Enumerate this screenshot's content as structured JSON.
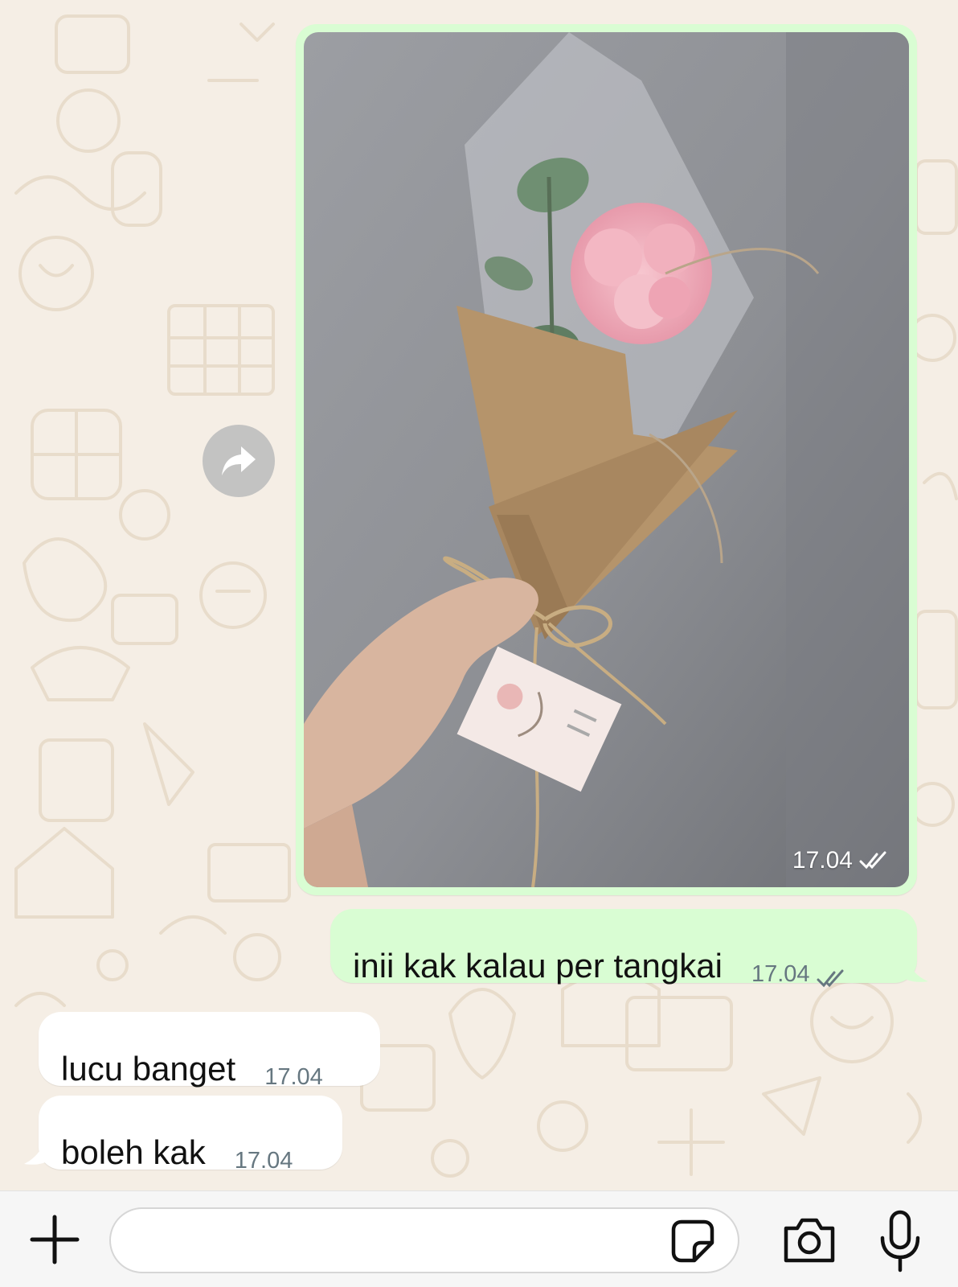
{
  "conversation": {
    "messages": [
      {
        "direction": "outgoing",
        "type": "image",
        "time": "17.04",
        "status_icon": "double-check-icon",
        "image_desc_icon": "flower-bouquet-photo"
      },
      {
        "direction": "outgoing",
        "type": "text",
        "text": "inii kak kalau per tangkai",
        "time": "17.04",
        "status_icon": "double-check-icon"
      },
      {
        "direction": "incoming",
        "type": "text",
        "text": "lucu banget",
        "time": "17.04"
      },
      {
        "direction": "incoming",
        "type": "text",
        "text": "boleh kak",
        "time": "17.04"
      }
    ]
  },
  "input_bar": {
    "placeholder": "",
    "icons": [
      "plus-icon",
      "sticker-icon",
      "camera-icon",
      "microphone-icon"
    ]
  },
  "colors": {
    "outgoing_bubble": "#d9fdd3",
    "incoming_bubble": "#ffffff",
    "wallpaper": "#f5eee5",
    "timestamp": "#667780"
  }
}
